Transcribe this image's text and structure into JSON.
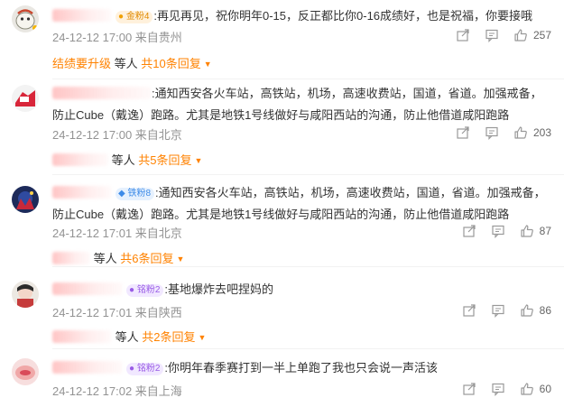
{
  "comments": [
    {
      "badge_text": "金粉4",
      "text": ":再见再见，祝你明年0-15，反正都比你0-16成绩好，也是祝福，你要接哦",
      "meta": "24-12-12 17:00 来自贵州",
      "likes": "257",
      "reply_prefix": "结绩要升级",
      "reply_mid": "等人",
      "reply_count": "共10条回复"
    },
    {
      "badge_text": "",
      "text": ":通知西安各火车站，高铁站，机场，高速收费站，国道，省道。加强戒备，防止Cube（戴逸）跑路。尤其是地铁1号线做好与咸阳西站的沟通，防止他借道咸阳跑路",
      "meta": "24-12-12 17:00 来自北京",
      "likes": "203",
      "reply_prefix": "",
      "reply_mid": "等人",
      "reply_count": "共5条回复"
    },
    {
      "badge_text": "铁粉8",
      "text": ":通知西安各火车站，高铁站，机场，高速收费站，国道，省道。加强戒备，防止Cube（戴逸）跑路。尤其是地铁1号线做好与咸阳西站的沟通，防止他借道咸阳跑路",
      "meta": "24-12-12 17:01 来自北京",
      "likes": "87",
      "reply_prefix": "",
      "reply_mid": "等人",
      "reply_count": "共6条回复"
    },
    {
      "badge_text": "铭粉2",
      "text": ":基地爆炸去吧捏妈的",
      "meta": "24-12-12 17:01 来自陕西",
      "likes": "86",
      "reply_prefix": "",
      "reply_mid": "等人",
      "reply_count": "共2条回复"
    },
    {
      "badge_text": "铭粉2",
      "text": ":你明年春季赛打到一半上单跑了我也只会说一声活该",
      "meta": "24-12-12 17:02 来自上海",
      "likes": "60"
    }
  ],
  "icons": {
    "share": "share-icon",
    "comment": "comment-icon",
    "like": "thumbs-up-icon",
    "reply_toggle": "caret-down-icon"
  },
  "colors": {
    "accent_orange": "#ff8200",
    "meta_gray": "#939393",
    "gold_badge": "#e08a00",
    "blue_badge": "#3d8be8",
    "purple_badge": "#9a5ce6"
  }
}
